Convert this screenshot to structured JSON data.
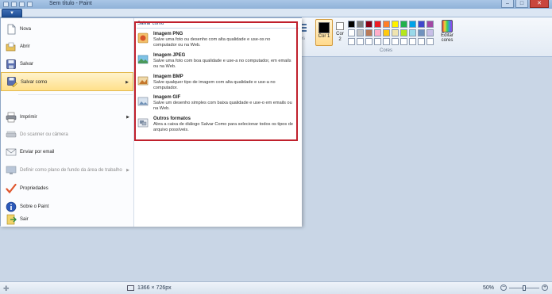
{
  "window": {
    "title": "Sem título - Paint",
    "min": "–",
    "max": "□",
    "close": "✕"
  },
  "file_menu_button": "▾",
  "ribbon": {
    "partial_label": "nhos",
    "color1_label": "Cor 1",
    "color2_label": "Cor 2",
    "edit_colors_label": "Editar cores",
    "group_label": "Cores",
    "palette": [
      "#000000",
      "#7f7f7f",
      "#880015",
      "#ed1c24",
      "#ff7f27",
      "#fff200",
      "#22b14c",
      "#00a2e8",
      "#3f48cc",
      "#a349a4",
      "#ffffff",
      "#c3c3c3",
      "#b97a57",
      "#ffaec9",
      "#ffc90e",
      "#efe4b0",
      "#b5e61d",
      "#99d9ea",
      "#7092be",
      "#c8bfe7",
      "#ffffff",
      "#ffffff",
      "#ffffff",
      "#ffffff",
      "#ffffff",
      "#ffffff",
      "#ffffff",
      "#ffffff",
      "#ffffff",
      "#ffffff"
    ]
  },
  "menu": {
    "items": [
      {
        "label": "Nova"
      },
      {
        "label": "Abrir"
      },
      {
        "label": "Salvar"
      },
      {
        "label": "Salvar como",
        "arrow": "▶"
      },
      {
        "label": "Imprimir",
        "arrow": "▶"
      },
      {
        "label": "Do scanner ou câmera"
      },
      {
        "label": "Enviar por email"
      },
      {
        "label": "Definir como plano de fundo da área de trabalho",
        "arrow": "▶"
      },
      {
        "label": "Propriedades"
      },
      {
        "label": "Sobre o Paint"
      },
      {
        "label": "Sair"
      }
    ]
  },
  "save_as": {
    "title": "Salvar como",
    "options": [
      {
        "title": "Imagem PNG",
        "desc": "Salve uma foto ou desenho com alta qualidade e use-os no computador ou na Web."
      },
      {
        "title": "Imagem JPEG",
        "desc": "Salve uma foto com boa qualidade e use-a no computador, em emails ou na Web."
      },
      {
        "title": "Imagem BMP",
        "desc": "Salve qualquer tipo de imagem com alta qualidade e use-a no computador."
      },
      {
        "title": "Imagem GIF",
        "desc": "Salve um desenho simples com baixa qualidade e use-o em emails ou na Web."
      },
      {
        "title": "Outros formatos",
        "desc": "Abra a caixa de diálogo Salvar Como para selecionar todos os tipos de arquivo possíveis."
      }
    ]
  },
  "status": {
    "cross": "✛",
    "dimensions": "1366 × 726px",
    "zoom": "50%",
    "zoom_minus": "−",
    "zoom_plus": "+",
    "zoom_fraction": 0.5
  }
}
